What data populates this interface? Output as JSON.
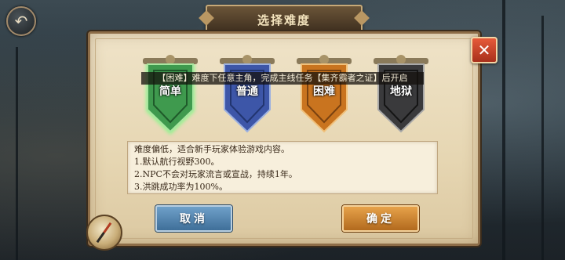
{
  "header": {
    "title": "选择难度"
  },
  "nav": {
    "back_icon": "back-arrow-icon"
  },
  "dialog": {
    "close_icon": "close-icon",
    "hint": "【困难】难度下任意主角，完成主线任务【集齐霸者之证】后开启",
    "difficulties": [
      {
        "label": "简单",
        "color": "#3f9a4e",
        "glow": "#6cff7a",
        "selected": true
      },
      {
        "label": "普通",
        "color": "#3d56a8",
        "glow": "",
        "selected": false
      },
      {
        "label": "困难",
        "color": "#c9741f",
        "glow": "",
        "selected": false
      },
      {
        "label": "地狱",
        "color": "#3a3a3c",
        "glow": "",
        "selected": false
      }
    ],
    "description": {
      "lines": [
        "难度偏低，适合新手玩家体验游戏内容。",
        "1.默认航行视野300。",
        "2.NPC不会对玩家流言或宣战，持续1年。",
        "3.洪跳成功率为100%。"
      ]
    },
    "cancel_label": "取消",
    "confirm_label": "确定"
  },
  "colors": {
    "panel": "#e6d6b2",
    "cancel_button": "#4f7fab",
    "confirm_button": "#cf8434",
    "close_button": "#d2462b"
  }
}
